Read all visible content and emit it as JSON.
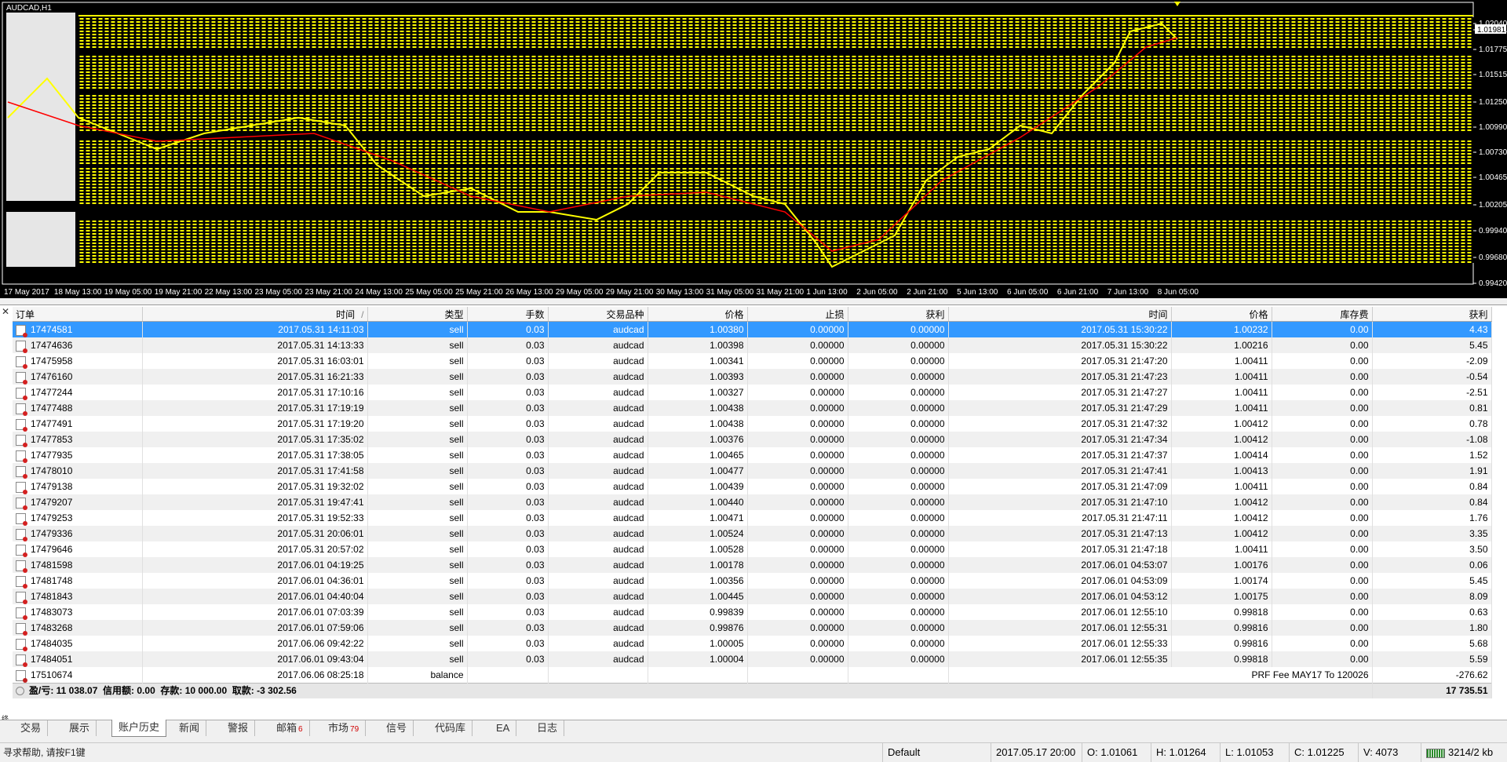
{
  "chart": {
    "symbol_title": "AUDCAD,H1",
    "price_labels": [
      "1.02040",
      "1.01981",
      "1.01775",
      "1.01515",
      "1.01250",
      "1.00990",
      "1.00730",
      "1.00465",
      "1.00205",
      "0.99940",
      "0.99680",
      "0.99420"
    ],
    "current_price": "1.01981",
    "time_labels": [
      "17 May 2017",
      "18 May 13:00",
      "19 May 05:00",
      "19 May 21:00",
      "22 May 13:00",
      "23 May 05:00",
      "23 May 21:00",
      "24 May 13:00",
      "25 May 05:00",
      "25 May 21:00",
      "26 May 13:00",
      "29 May 05:00",
      "29 May 21:00",
      "30 May 13:00",
      "31 May 05:00",
      "31 May 21:00",
      "1 Jun 13:00",
      "2 Jun 05:00",
      "2 Jun 21:00",
      "5 Jun 13:00",
      "6 Jun 05:00",
      "6 Jun 21:00",
      "7 Jun 13:00",
      "8 Jun 05:00"
    ],
    "colors": {
      "background": "#000000",
      "lines": "#ffff00",
      "candles": "#ffff00",
      "moving_average": "#ff0000"
    }
  },
  "terminal": {
    "close_icon": "close-icon",
    "side_label": "终端",
    "columns": [
      "订单",
      "时间",
      "类型",
      "手数",
      "交易品种",
      "价格",
      "止损",
      "获利",
      "时间",
      "价格",
      "库存费",
      "获利"
    ],
    "sort_marker": "/",
    "rows": [
      [
        "17474581",
        "2017.05.31 14:11:03",
        "sell",
        "0.03",
        "audcad",
        "1.00380",
        "0.00000",
        "0.00000",
        "2017.05.31 15:30:22",
        "1.00232",
        "0.00",
        "4.43"
      ],
      [
        "17474636",
        "2017.05.31 14:13:33",
        "sell",
        "0.03",
        "audcad",
        "1.00398",
        "0.00000",
        "0.00000",
        "2017.05.31 15:30:22",
        "1.00216",
        "0.00",
        "5.45"
      ],
      [
        "17475958",
        "2017.05.31 16:03:01",
        "sell",
        "0.03",
        "audcad",
        "1.00341",
        "0.00000",
        "0.00000",
        "2017.05.31 21:47:20",
        "1.00411",
        "0.00",
        "-2.09"
      ],
      [
        "17476160",
        "2017.05.31 16:21:33",
        "sell",
        "0.03",
        "audcad",
        "1.00393",
        "0.00000",
        "0.00000",
        "2017.05.31 21:47:23",
        "1.00411",
        "0.00",
        "-0.54"
      ],
      [
        "17477244",
        "2017.05.31 17:10:16",
        "sell",
        "0.03",
        "audcad",
        "1.00327",
        "0.00000",
        "0.00000",
        "2017.05.31 21:47:27",
        "1.00411",
        "0.00",
        "-2.51"
      ],
      [
        "17477488",
        "2017.05.31 17:19:19",
        "sell",
        "0.03",
        "audcad",
        "1.00438",
        "0.00000",
        "0.00000",
        "2017.05.31 21:47:29",
        "1.00411",
        "0.00",
        "0.81"
      ],
      [
        "17477491",
        "2017.05.31 17:19:20",
        "sell",
        "0.03",
        "audcad",
        "1.00438",
        "0.00000",
        "0.00000",
        "2017.05.31 21:47:32",
        "1.00412",
        "0.00",
        "0.78"
      ],
      [
        "17477853",
        "2017.05.31 17:35:02",
        "sell",
        "0.03",
        "audcad",
        "1.00376",
        "0.00000",
        "0.00000",
        "2017.05.31 21:47:34",
        "1.00412",
        "0.00",
        "-1.08"
      ],
      [
        "17477935",
        "2017.05.31 17:38:05",
        "sell",
        "0.03",
        "audcad",
        "1.00465",
        "0.00000",
        "0.00000",
        "2017.05.31 21:47:37",
        "1.00414",
        "0.00",
        "1.52"
      ],
      [
        "17478010",
        "2017.05.31 17:41:58",
        "sell",
        "0.03",
        "audcad",
        "1.00477",
        "0.00000",
        "0.00000",
        "2017.05.31 21:47:41",
        "1.00413",
        "0.00",
        "1.91"
      ],
      [
        "17479138",
        "2017.05.31 19:32:02",
        "sell",
        "0.03",
        "audcad",
        "1.00439",
        "0.00000",
        "0.00000",
        "2017.05.31 21:47:09",
        "1.00411",
        "0.00",
        "0.84"
      ],
      [
        "17479207",
        "2017.05.31 19:47:41",
        "sell",
        "0.03",
        "audcad",
        "1.00440",
        "0.00000",
        "0.00000",
        "2017.05.31 21:47:10",
        "1.00412",
        "0.00",
        "0.84"
      ],
      [
        "17479253",
        "2017.05.31 19:52:33",
        "sell",
        "0.03",
        "audcad",
        "1.00471",
        "0.00000",
        "0.00000",
        "2017.05.31 21:47:11",
        "1.00412",
        "0.00",
        "1.76"
      ],
      [
        "17479336",
        "2017.05.31 20:06:01",
        "sell",
        "0.03",
        "audcad",
        "1.00524",
        "0.00000",
        "0.00000",
        "2017.05.31 21:47:13",
        "1.00412",
        "0.00",
        "3.35"
      ],
      [
        "17479646",
        "2017.05.31 20:57:02",
        "sell",
        "0.03",
        "audcad",
        "1.00528",
        "0.00000",
        "0.00000",
        "2017.05.31 21:47:18",
        "1.00411",
        "0.00",
        "3.50"
      ],
      [
        "17481598",
        "2017.06.01 04:19:25",
        "sell",
        "0.03",
        "audcad",
        "1.00178",
        "0.00000",
        "0.00000",
        "2017.06.01 04:53:07",
        "1.00176",
        "0.00",
        "0.06"
      ],
      [
        "17481748",
        "2017.06.01 04:36:01",
        "sell",
        "0.03",
        "audcad",
        "1.00356",
        "0.00000",
        "0.00000",
        "2017.06.01 04:53:09",
        "1.00174",
        "0.00",
        "5.45"
      ],
      [
        "17481843",
        "2017.06.01 04:40:04",
        "sell",
        "0.03",
        "audcad",
        "1.00445",
        "0.00000",
        "0.00000",
        "2017.06.01 04:53:12",
        "1.00175",
        "0.00",
        "8.09"
      ],
      [
        "17483073",
        "2017.06.01 07:03:39",
        "sell",
        "0.03",
        "audcad",
        "0.99839",
        "0.00000",
        "0.00000",
        "2017.06.01 12:55:10",
        "0.99818",
        "0.00",
        "0.63"
      ],
      [
        "17483268",
        "2017.06.01 07:59:06",
        "sell",
        "0.03",
        "audcad",
        "0.99876",
        "0.00000",
        "0.00000",
        "2017.06.01 12:55:31",
        "0.99816",
        "0.00",
        "1.80"
      ],
      [
        "17484035",
        "2017.06.06 09:42:22",
        "sell",
        "0.03",
        "audcad",
        "1.00005",
        "0.00000",
        "0.00000",
        "2017.06.01 12:55:33",
        "0.99816",
        "0.00",
        "5.68"
      ],
      [
        "17484051",
        "2017.06.01 09:43:04",
        "sell",
        "0.03",
        "audcad",
        "1.00004",
        "0.00000",
        "0.00000",
        "2017.06.01 12:55:35",
        "0.99818",
        "0.00",
        "5.59"
      ]
    ],
    "balance_row": {
      "order": "17510674",
      "time": "2017.06.06 08:25:18",
      "type": "balance",
      "comment": "PRF Fee MAY17 To 120026",
      "profit": "-276.62"
    },
    "summary": {
      "text": "盈/亏: 11 038.07  信用额: 0.00  存款: 10 000.00  取款: -3 302.56",
      "total": "17 735.51"
    }
  },
  "tabs": [
    {
      "label": "交易",
      "badge": ""
    },
    {
      "label": "展示",
      "badge": ""
    },
    {
      "label": "账户历史",
      "badge": "",
      "active": true
    },
    {
      "label": "新闻",
      "badge": ""
    },
    {
      "label": "警报",
      "badge": ""
    },
    {
      "label": "邮箱",
      "badge": "6"
    },
    {
      "label": "市场",
      "badge": "79"
    },
    {
      "label": "信号",
      "badge": ""
    },
    {
      "label": "代码库",
      "badge": ""
    },
    {
      "label": "EA",
      "badge": ""
    },
    {
      "label": "日志",
      "badge": ""
    }
  ],
  "status_bar": {
    "help": "寻求帮助, 请按F1键",
    "profile": "Default",
    "datetime": "2017.05.17 20:00",
    "open": "O: 1.01061",
    "high": "H: 1.01264",
    "low": "L: 1.01053",
    "close": "C: 1.01225",
    "volume": "V: 4073",
    "traffic": "3214/2 kb"
  }
}
